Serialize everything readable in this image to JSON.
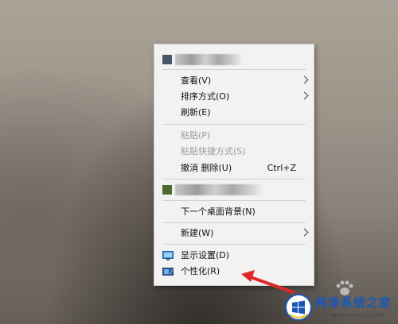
{
  "context_menu": {
    "items": [
      {
        "label": "查看(V)",
        "submenu": true
      },
      {
        "label": "排序方式(O)",
        "submenu": true
      },
      {
        "label": "刷新(E)"
      },
      {
        "label": "粘贴(P)",
        "disabled": true
      },
      {
        "label": "粘贴快捷方式(S)",
        "disabled": true
      },
      {
        "label": "撤消 删除(U)",
        "shortcut": "Ctrl+Z"
      },
      {
        "label": "下一个桌面背景(N)"
      },
      {
        "label": "新建(W)",
        "submenu": true
      },
      {
        "label": "显示设置(D)",
        "icon": "display-settings-icon"
      },
      {
        "label": "个性化(R)",
        "icon": "personalize-icon"
      }
    ]
  },
  "watermark": {
    "title": "纯净系统之家",
    "url": "www.ycwjzy.com"
  },
  "colors": {
    "menu_bg": "#f2f2f2",
    "annotation_arrow": "#e0282b",
    "watermark_blue": "#1a57b8"
  }
}
